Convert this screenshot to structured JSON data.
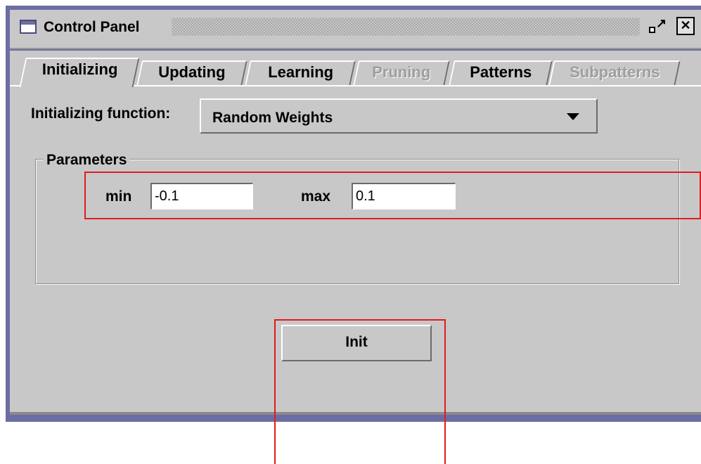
{
  "window": {
    "title": "Control Panel"
  },
  "tabs": [
    {
      "label": "Initializing",
      "state": "active"
    },
    {
      "label": "Updating",
      "state": "enabled"
    },
    {
      "label": "Learning",
      "state": "enabled"
    },
    {
      "label": "Pruning",
      "state": "disabled"
    },
    {
      "label": "Patterns",
      "state": "enabled"
    },
    {
      "label": "Subpatterns",
      "state": "disabled"
    }
  ],
  "init_function": {
    "label": "Initializing function:",
    "selected": "Random Weights"
  },
  "parameters": {
    "legend": "Parameters",
    "min_label": "min",
    "min_value": "-0.1",
    "max_label": "max",
    "max_value": "0.1"
  },
  "actions": {
    "init_label": "Init"
  },
  "colors": {
    "panel_background": "#c8c8c8",
    "window_frame": "#6b6ea3",
    "highlight": "#e01c1c",
    "disabled_text": "#9e9e9e"
  },
  "icons": {
    "window": "window-icon",
    "minimize": "minimize-icon",
    "close": "close-icon",
    "dropdown": "chevron-down-icon"
  }
}
